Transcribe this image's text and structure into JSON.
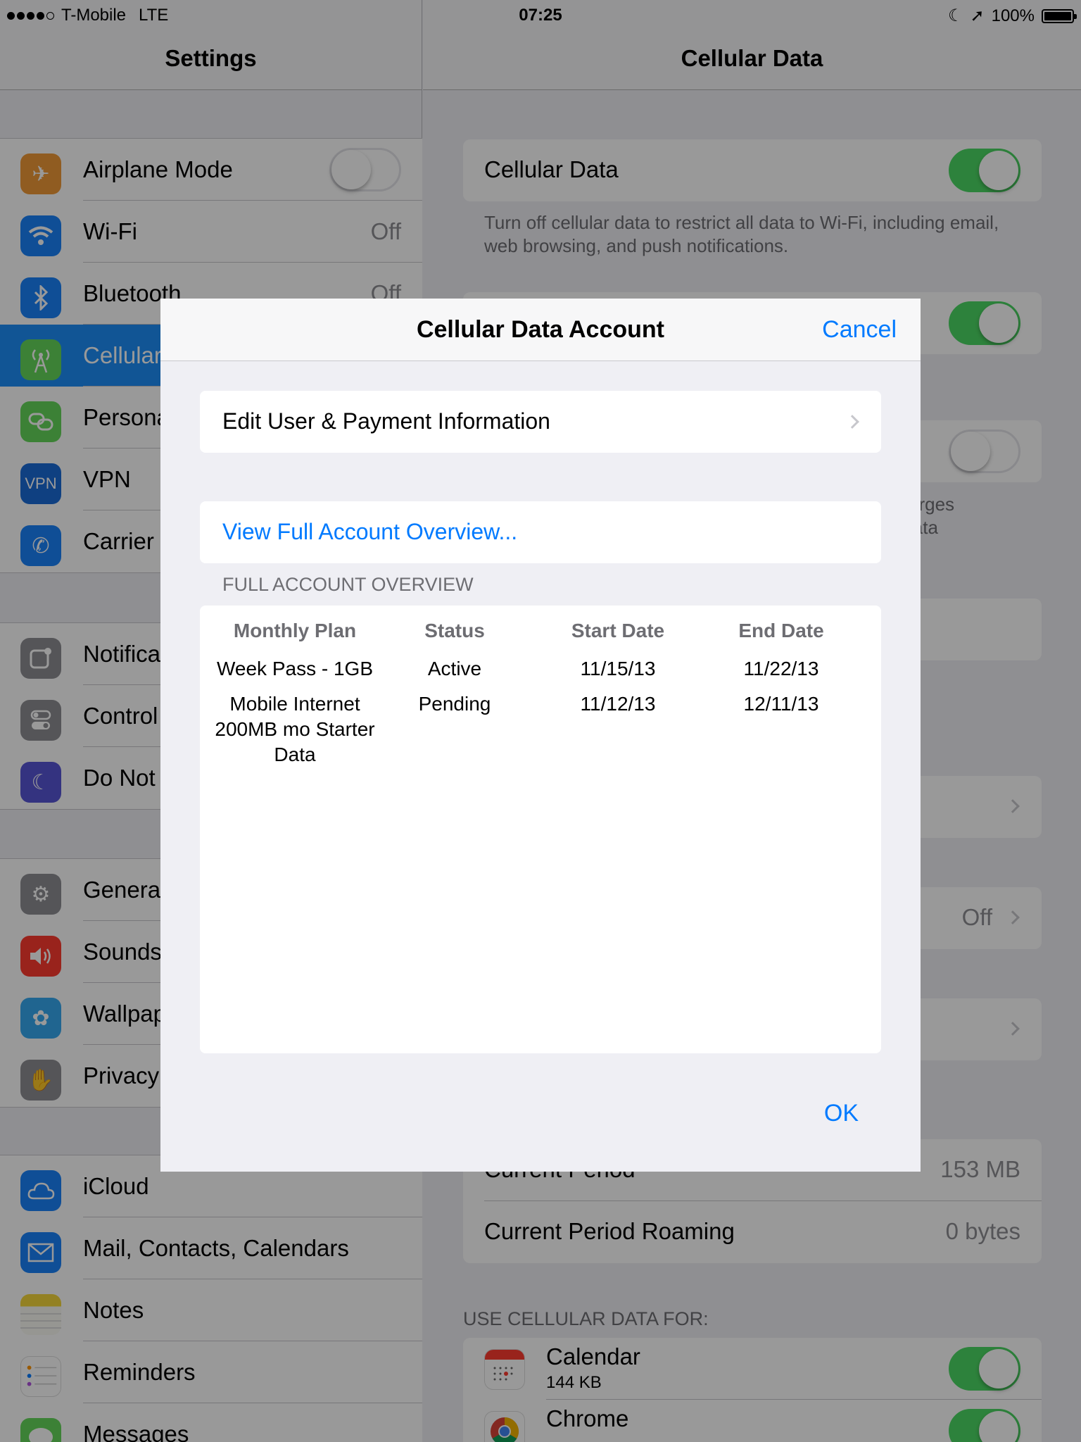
{
  "status_bar": {
    "carrier": "T-Mobile",
    "network": "LTE",
    "time": "07:25",
    "battery": "100%"
  },
  "master": {
    "title": "Settings",
    "group1": [
      {
        "label": "Airplane Mode",
        "icon": "airplane-icon",
        "color": "#f19a37"
      },
      {
        "label": "Wi-Fi",
        "value": "Off",
        "icon": "wifi-icon",
        "color": "#1a82fb"
      },
      {
        "label": "Bluetooth",
        "value": "Off",
        "icon": "bluetooth-icon",
        "color": "#1a82fb"
      },
      {
        "label": "Cellular",
        "icon": "cellular-icon",
        "color": "#65d85a"
      },
      {
        "label": "Personal",
        "icon": "hotspot-icon",
        "color": "#65d85a"
      },
      {
        "label": "VPN",
        "icon": "vpn-icon",
        "color": "#1a6bd8"
      },
      {
        "label": "Carrier",
        "icon": "phone-icon",
        "color": "#1a82fb"
      }
    ],
    "group2": [
      {
        "label": "Notifica",
        "icon": "notifications-icon",
        "color": "#8e8e93"
      },
      {
        "label": "Control",
        "icon": "control-center-icon",
        "color": "#8e8e93"
      },
      {
        "label": "Do Not",
        "icon": "moon-icon",
        "color": "#5856d6"
      }
    ],
    "group3": [
      {
        "label": "Genera",
        "icon": "gear-icon",
        "color": "#8e8e93"
      },
      {
        "label": "Sounds",
        "icon": "speaker-icon",
        "color": "#ff3b30"
      },
      {
        "label": "Wallpap",
        "icon": "flower-icon",
        "color": "#36a9f0"
      },
      {
        "label": "Privacy",
        "icon": "hand-icon",
        "color": "#8e8e93"
      }
    ],
    "group4": [
      {
        "label": "iCloud",
        "icon": "cloud-icon",
        "color": "#1a82fb"
      },
      {
        "label": "Mail, Contacts, Calendars",
        "icon": "mail-icon",
        "color": "#1a82fb"
      },
      {
        "label": "Notes",
        "icon": "notes-icon",
        "color": "#f5d73b"
      },
      {
        "label": "Reminders",
        "icon": "reminders-icon",
        "color": "#ffffff"
      },
      {
        "label": "Messages",
        "icon": "messages-icon",
        "color": "#65d85a"
      }
    ]
  },
  "detail": {
    "title": "Cellular Data",
    "cellular_data_label": "Cellular Data",
    "cellular_data_note": "Turn off cellular data to restrict all data to Wi-Fi, including email, web browsing, and push notifications.",
    "roaming_note_fragment_1": "arges",
    "roaming_note_fragment_2": "lata",
    "row_off_value": "Off",
    "current_period_label": "Current Period",
    "current_period_value": "153 MB",
    "roaming_label": "Current Period Roaming",
    "roaming_value": "0 bytes",
    "use_cellular_header": "USE CELLULAR DATA FOR:",
    "apps": [
      {
        "name": "Calendar",
        "size": "144 KB",
        "icon": "calendar-icon"
      },
      {
        "name": "Chrome",
        "icon": "chrome-icon"
      }
    ]
  },
  "modal": {
    "title": "Cellular Data Account",
    "cancel": "Cancel",
    "edit_user": "Edit User & Payment Information",
    "view_overview": "View Full Account Overview...",
    "section_header": "FULL ACCOUNT OVERVIEW",
    "columns": [
      "Monthly Plan",
      "Status",
      "Start Date",
      "End Date"
    ],
    "rows": [
      [
        "Week Pass - 1GB",
        "Active",
        "11/15/13",
        "11/22/13"
      ],
      [
        "Mobile Internet 200MB mo Starter Data",
        "Pending",
        "11/12/13",
        "12/11/13"
      ]
    ],
    "ok": "OK"
  }
}
